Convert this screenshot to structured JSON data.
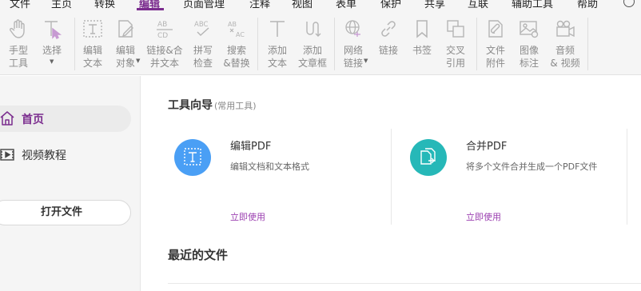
{
  "menu": {
    "items": [
      {
        "label": "文件"
      },
      {
        "label": "主页"
      },
      {
        "label": "转换"
      },
      {
        "label": "编辑"
      },
      {
        "label": "页面管理"
      },
      {
        "label": "注释"
      },
      {
        "label": "视图"
      },
      {
        "label": "表单"
      },
      {
        "label": "保护"
      },
      {
        "label": "共享"
      },
      {
        "label": "互联"
      },
      {
        "label": "辅助工具"
      },
      {
        "label": "帮助"
      }
    ],
    "active": "编辑"
  },
  "ribbon": {
    "tools": [
      {
        "label": "手型\n工具",
        "icon": "hand-icon"
      },
      {
        "label": "选择",
        "icon": "select-icon",
        "dropdown": true
      },
      {
        "label": "编辑\n文本",
        "icon": "edit-text-icon"
      },
      {
        "label": "编辑\n对象",
        "icon": "edit-object-icon",
        "dropdown": true
      },
      {
        "label": "链接&合\n并文本",
        "icon": "link-merge-text-icon"
      },
      {
        "label": "拼写\n检查",
        "icon": "spell-check-icon"
      },
      {
        "label": "搜索\n&替换",
        "icon": "search-replace-icon"
      },
      {
        "label": "添加\n文本",
        "icon": "add-text-icon"
      },
      {
        "label": "添加\n文章框",
        "icon": "add-article-icon"
      },
      {
        "label": "网络\n链接",
        "icon": "web-link-icon",
        "dropdown": true
      },
      {
        "label": "链接",
        "icon": "link-icon"
      },
      {
        "label": "书签",
        "icon": "bookmark-icon"
      },
      {
        "label": "交叉\n引用",
        "icon": "cross-reference-icon"
      },
      {
        "label": "文件\n附件",
        "icon": "file-attachment-icon"
      },
      {
        "label": "图像\n标注",
        "icon": "image-annotation-icon"
      },
      {
        "label": "音频\n& 视频",
        "icon": "audio-video-icon"
      }
    ]
  },
  "sidebar": {
    "items": [
      {
        "label": "首页",
        "icon": "home-icon",
        "active": true
      },
      {
        "label": "视频教程",
        "icon": "video-icon",
        "active": false
      }
    ],
    "open_file_label": "打开文件"
  },
  "main": {
    "guide_title": "工具向导",
    "guide_subtitle": "(常用工具)",
    "cards": [
      {
        "title": "编辑PDF",
        "desc": "编辑文档和文本格式",
        "link": "立即使用",
        "icon": "edit-pdf-icon",
        "color": "#4a9ff5"
      },
      {
        "title": "合并PDF",
        "desc": "将多个文件合并生成一个PDF文件",
        "link": "立即使用",
        "icon": "merge-pdf-icon",
        "color": "#26b8b8"
      }
    ],
    "recent_title": "最近的文件"
  },
  "colors": {
    "accent": "#7b2d8e",
    "link": "#9b3fb0",
    "icon_gray": "#b5b5b5"
  }
}
